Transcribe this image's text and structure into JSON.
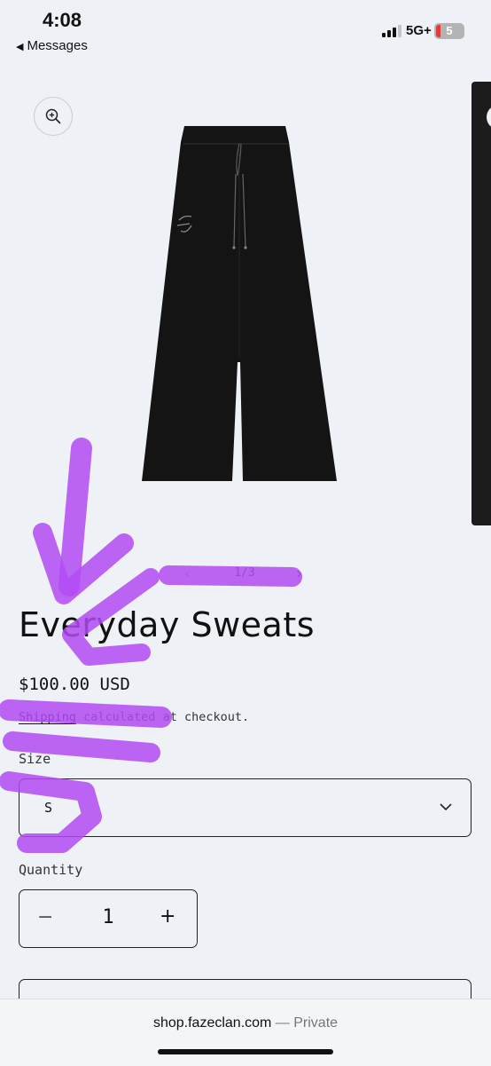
{
  "status_bar": {
    "time": "4:08",
    "back_label": "Messages",
    "network": "5G+",
    "battery": "5"
  },
  "gallery": {
    "zoom_icon": "zoom-in-icon",
    "counter": "1/3",
    "prev_icon": "chevron-left-icon",
    "next_icon": "chevron-right-icon"
  },
  "product": {
    "title": "Everyday Sweats",
    "price": "$100.00 USD",
    "shipping_link": "Shipping",
    "shipping_rest": " calculated at checkout.",
    "size_label": "Size",
    "size_value": "S",
    "quantity_label": "Quantity",
    "quantity_value": "1",
    "minus": "−",
    "plus": "+"
  },
  "browser": {
    "url": "shop.fazeclan.com",
    "separator": " — ",
    "mode": "Private"
  },
  "colors": {
    "background": "#eef2f7",
    "annotation": "#b24bf3"
  }
}
